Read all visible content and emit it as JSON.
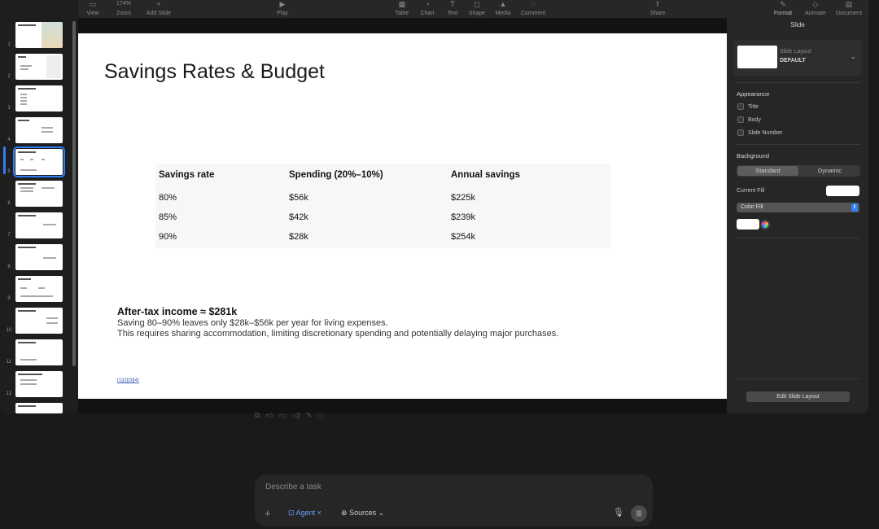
{
  "toolbar": {
    "view": "View",
    "zoom": "174%",
    "zoom_label": "Zoom",
    "add_slide": "Add Slide",
    "play": "Play",
    "table": "Table",
    "chart": "Chart",
    "text": "Text",
    "shape": "Shape",
    "media": "Media",
    "comment": "Comment",
    "share": "Share",
    "format": "Format",
    "animate": "Animate",
    "document": "Document"
  },
  "navigator": {
    "numbers": [
      "1",
      "2",
      "3",
      "4",
      "5",
      "6",
      "7",
      "8",
      "9",
      "10",
      "11",
      "12"
    ],
    "selected": "5"
  },
  "slide": {
    "title": "Savings Rates & Budget",
    "table": {
      "headers": [
        "Savings rate",
        "Spending (20%–10%)",
        "Annual savings"
      ],
      "rows": [
        [
          "80%",
          "$56k",
          "$225k"
        ],
        [
          "85%",
          "$42k",
          "$239k"
        ],
        [
          "90%",
          "$28k",
          "$254k"
        ]
      ]
    },
    "after_title": "After-tax income ≈ $281k",
    "after_line1": "Saving 80–90% leaves only $28k–$56k per year for living expenses.",
    "after_line2": "This requires sharing accommodation, limiting discretionary spending and potentially delaying major purchases.",
    "citations": "[1][2][3][4]"
  },
  "inspector": {
    "tab": "Slide",
    "layout_label": "Slide Layout",
    "layout_value": "DEFAULT",
    "appearance": "Appearance",
    "title_chk": "Title",
    "body_chk": "Body",
    "slide_number_chk": "Slide Number",
    "background": "Background",
    "standard": "Standard",
    "dynamic": "Dynamic",
    "current_fill": "Current Fill",
    "fill_type": "Color Fill",
    "edit_layout": "Edit Slide Layout"
  },
  "prompt": {
    "placeholder": "Describe a task",
    "agent": "Agent",
    "sources": "Sources"
  },
  "colors": {
    "accent": "#2f7ff5",
    "slide_bg": "#ffffff",
    "app_bg": "#1e1e1e"
  }
}
